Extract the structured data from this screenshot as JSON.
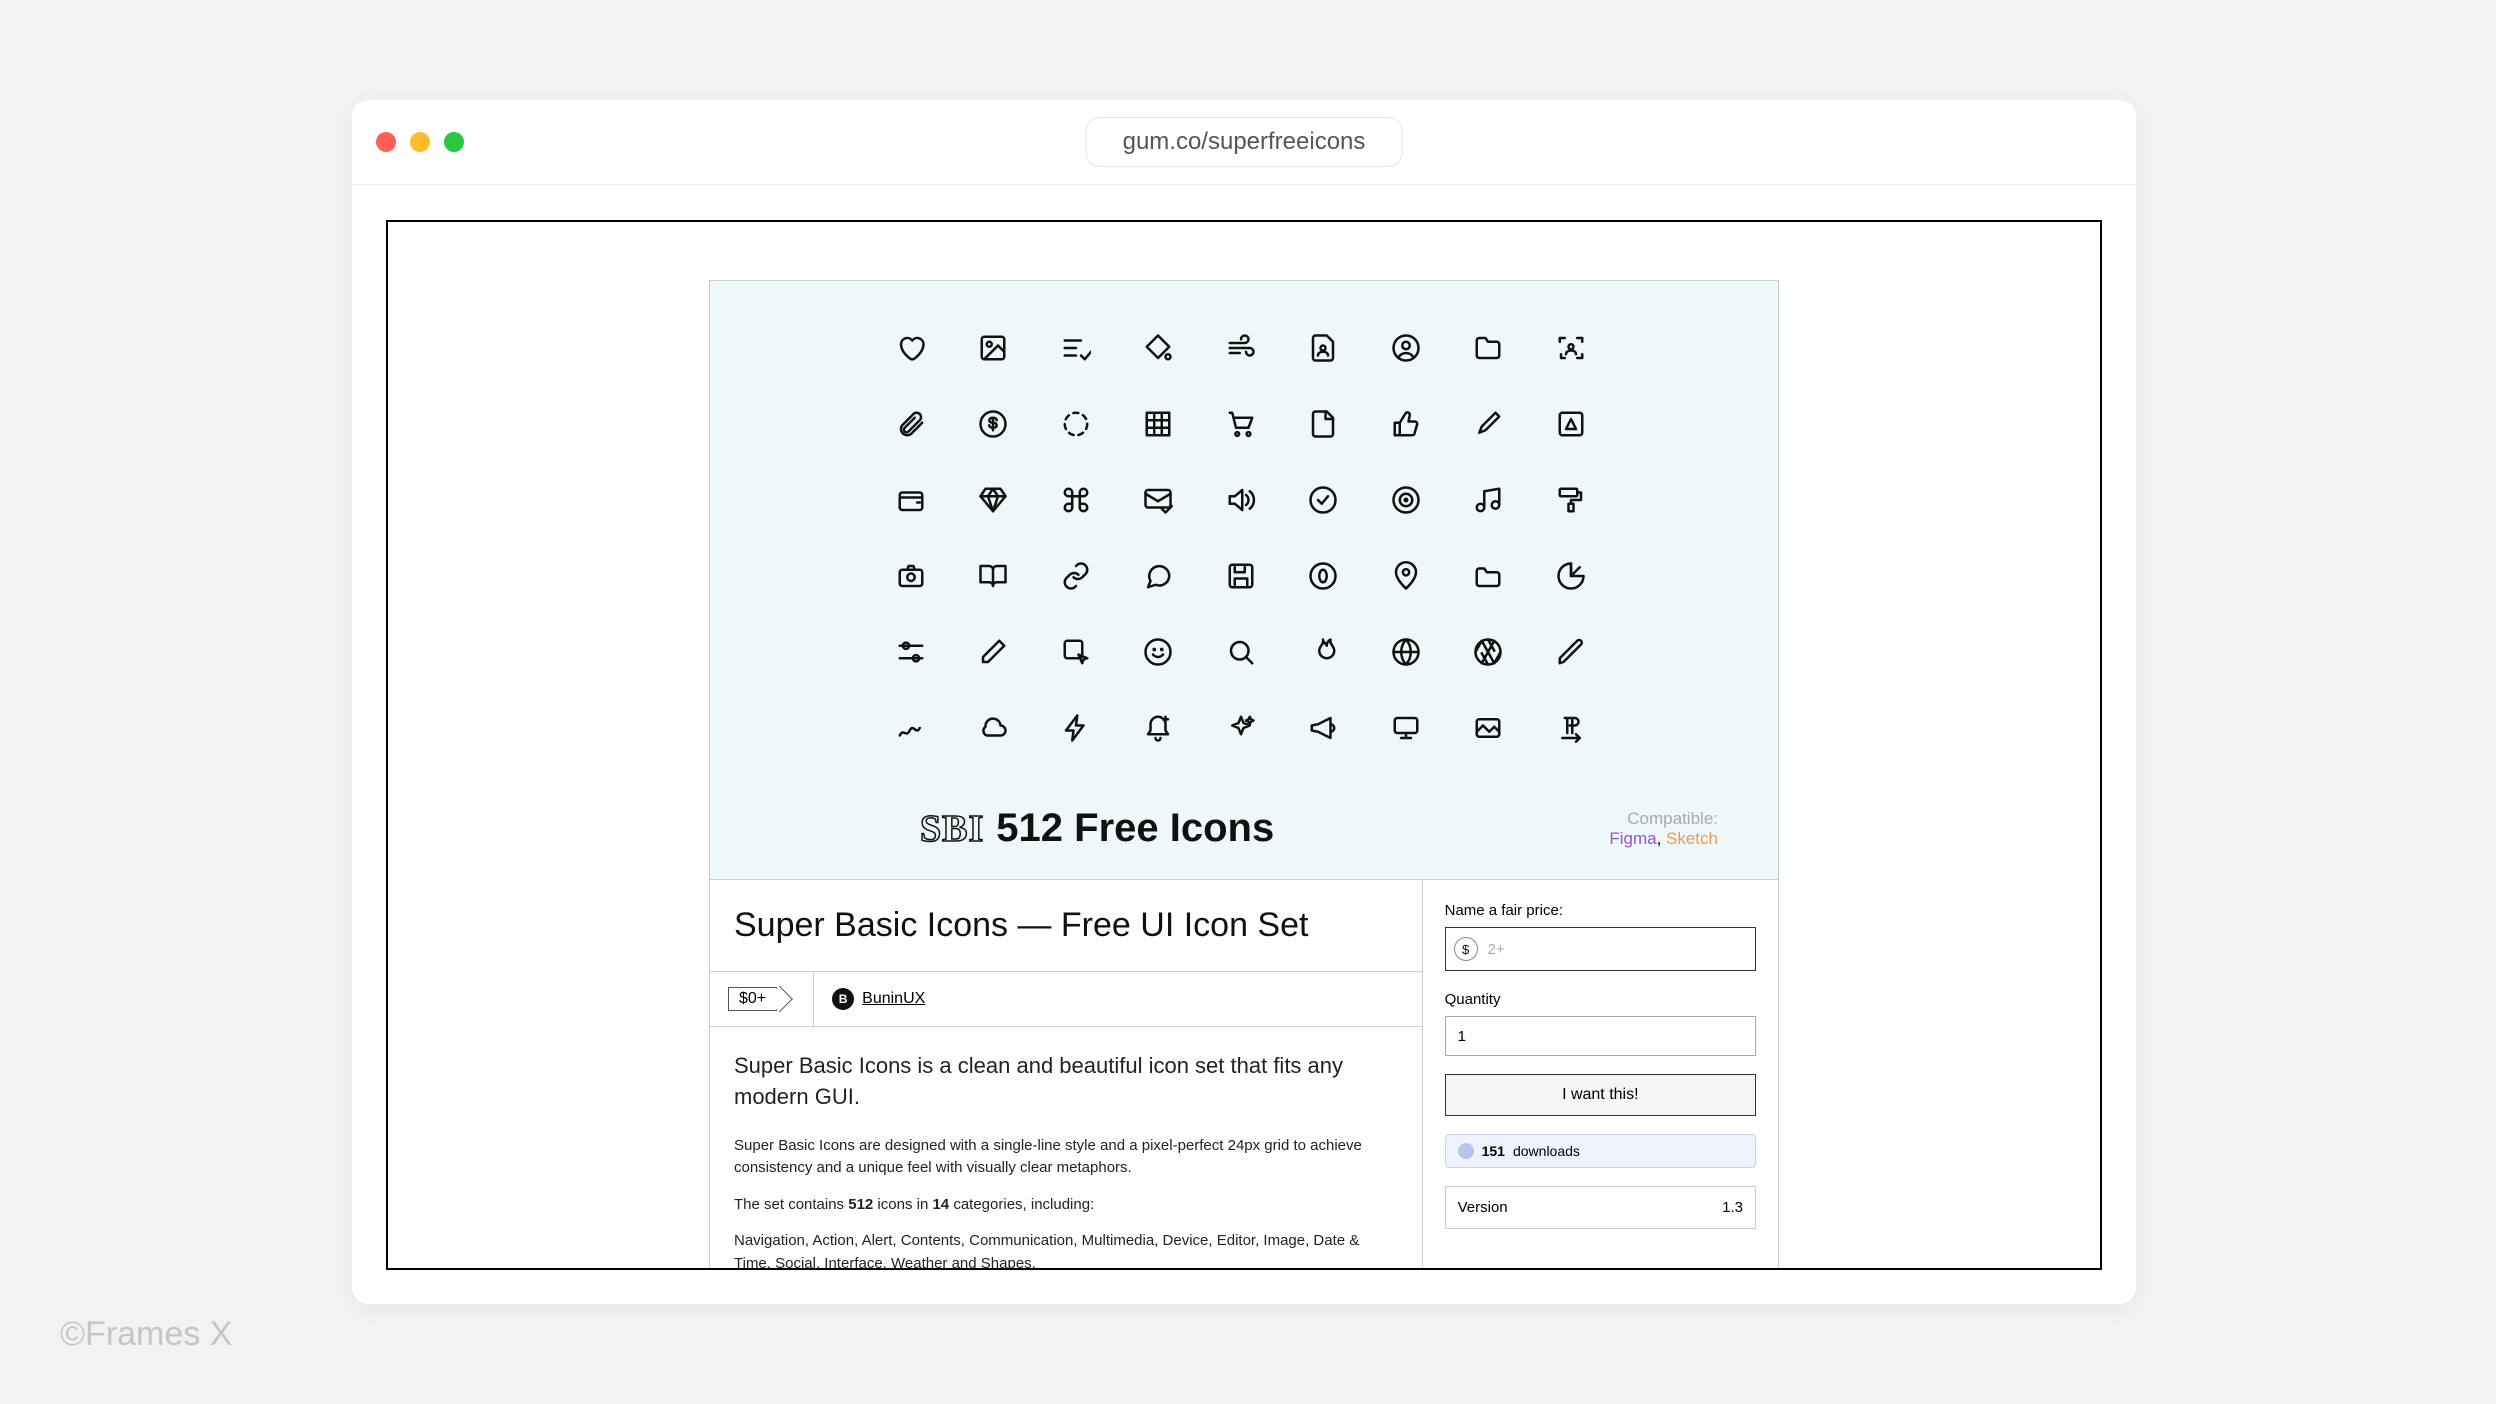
{
  "url": "gum.co/superfreeicons",
  "hero": {
    "badge": "SBI",
    "title": "512 Free Icons",
    "compat_label": "Compatible:",
    "compat_figma": "Figma",
    "compat_sketch": "Sketch"
  },
  "product": {
    "title": "Super Basic Icons — Free UI Icon Set",
    "price_tag": "$0+",
    "author_initials": "B",
    "author_name": "BuninUX",
    "desc_lead": "Super Basic Icons is a clean and beautiful icon set that fits any modern GUI.",
    "desc_p1": "Super Basic Icons are designed with a single-line style and a pixel-perfect 24px grid to achieve consistency and a unique feel with visually clear metaphors.",
    "desc_p2_a": "The set contains ",
    "desc_p2_b": "512",
    "desc_p2_c": " icons in ",
    "desc_p2_d": "14",
    "desc_p2_e": " categories, including:",
    "desc_p3": "Navigation, Action, Alert, Contents, Communication, Multimedia, Device, Editor, Image, Date & Time, Social, Interface, Weather and Shapes."
  },
  "purchase": {
    "price_label": "Name a fair price:",
    "currency": "$",
    "price_placeholder": "2+",
    "qty_label": "Quantity",
    "qty_value": "1",
    "buy_label": "I want this!",
    "downloads_count": "151",
    "downloads_label": "downloads",
    "version_label": "Version",
    "version_value": "1.3"
  },
  "watermark": "©Frames X",
  "icons": [
    "heart",
    "image",
    "playlist-check",
    "paint-bucket",
    "wind",
    "file-user",
    "user-circle",
    "folder",
    "scan-user",
    "paperclip",
    "dollar-circle",
    "loading-circle",
    "grid",
    "shopping-cart",
    "file",
    "thumbs-up",
    "brush",
    "picture-frame",
    "wallet",
    "diamond",
    "command",
    "mail-check",
    "volume",
    "check-circle",
    "target",
    "music",
    "paint-roller",
    "camera",
    "book-open",
    "link",
    "chat",
    "save",
    "zero-circle",
    "map-pin",
    "folder-alt",
    "pie-chart",
    "sliders",
    "edit",
    "cursor-box",
    "smile",
    "search",
    "fire",
    "globe",
    "aperture",
    "pen",
    "scribble",
    "cloud",
    "lightning",
    "notification-add",
    "sparkle",
    "megaphone",
    "desktop",
    "gallery",
    "text-direction"
  ]
}
